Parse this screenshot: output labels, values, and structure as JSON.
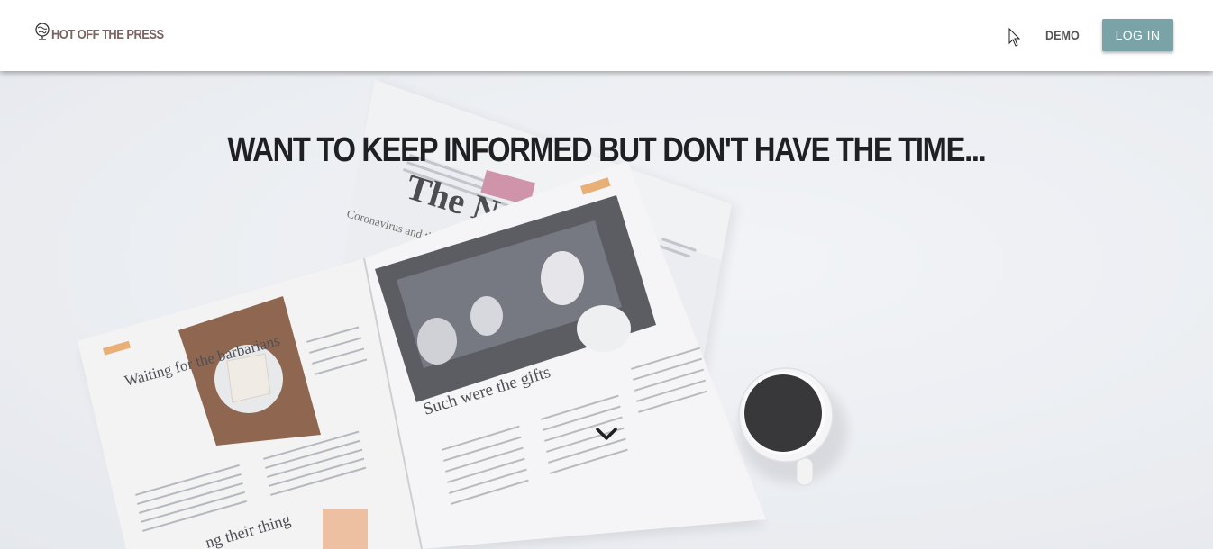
{
  "navbar": {
    "brand": "HOT OFF THE PRESS",
    "brand_icon": "globe-icon",
    "demo_label": "DEMO",
    "login_label": "LOG IN",
    "login_color": "#7aa3a7"
  },
  "hero": {
    "headline": "WANT TO KEEP INFORMED BUT DON'T HAVE THE TIME...",
    "scroll_icon": "chevron-down-icon",
    "background": "newspaper-and-coffee-photo",
    "newspaper_text": {
      "masthead": "The N",
      "back_headline": "Coronavirus and the fear of recession",
      "left_headline": "Waiting for the barbarians",
      "right_headline": "Such were the gifts",
      "bottom_headline": "ng their thing"
    }
  }
}
